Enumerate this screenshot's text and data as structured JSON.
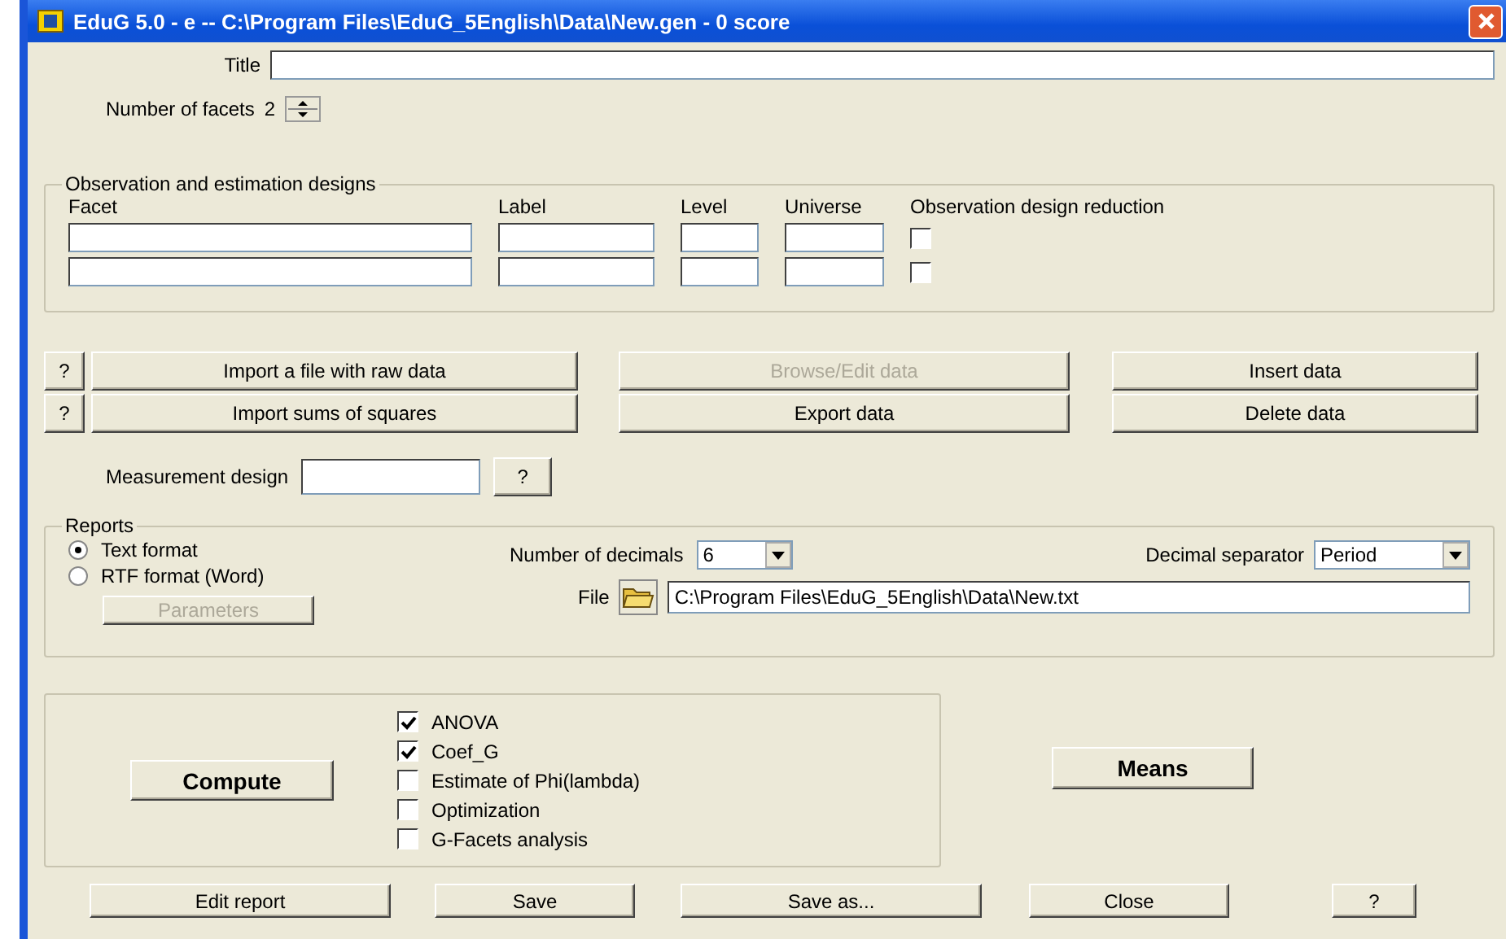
{
  "window": {
    "title": "EduG 5.0 - e -- C:\\Program Files\\EduG_5English\\Data\\New.gen - 0 score"
  },
  "title_field": {
    "label": "Title"
  },
  "facets": {
    "label": "Number of facets",
    "value": "2"
  },
  "observation": {
    "title": "Observation and estimation designs",
    "columns": [
      "Facet",
      "Label",
      "Level",
      "Universe",
      "Observation design reduction"
    ],
    "rows": [
      {
        "reduction": false
      },
      {
        "reduction": false
      }
    ]
  },
  "data_buttons": [
    [
      {
        "kind": "help",
        "label": "?",
        "disabled": false
      },
      {
        "kind": "action",
        "label": "Import a file with raw data",
        "disabled": false
      },
      {
        "kind": "action",
        "label": "Browse/Edit data",
        "disabled": true
      },
      {
        "kind": "action",
        "label": "Insert data",
        "disabled": false
      }
    ],
    [
      {
        "kind": "help",
        "label": "?",
        "disabled": false
      },
      {
        "kind": "action",
        "label": "Import sums of squares",
        "disabled": false
      },
      {
        "kind": "action",
        "label": "Export data",
        "disabled": false
      },
      {
        "kind": "action",
        "label": "Delete data",
        "disabled": false
      }
    ]
  ],
  "measurement": {
    "label": "Measurement design",
    "help": "?"
  },
  "reports": {
    "title": "Reports",
    "formats": [
      {
        "label": "Text format",
        "selected": true
      },
      {
        "label": "RTF format (Word)",
        "selected": false
      }
    ],
    "parameters": {
      "label": "Parameters",
      "disabled": true
    },
    "decimals": {
      "label": "Number of decimals",
      "value": "6"
    },
    "separator": {
      "label": "Decimal separator",
      "value": "Period"
    },
    "file": {
      "label": "File",
      "path": "C:\\Program Files\\EduG_5English\\Data\\New.txt"
    }
  },
  "compute": {
    "label": "Compute",
    "options": [
      {
        "label": "ANOVA",
        "checked": true
      },
      {
        "label": "Coef_G",
        "checked": true
      },
      {
        "label": "Estimate of Phi(lambda)",
        "checked": false
      },
      {
        "label": "Optimization",
        "checked": false
      },
      {
        "label": "G-Facets analysis",
        "checked": false
      }
    ]
  },
  "means": {
    "label": "Means"
  },
  "footer_buttons": [
    "Edit report",
    "Save",
    "Save as...",
    "Close",
    "?"
  ]
}
